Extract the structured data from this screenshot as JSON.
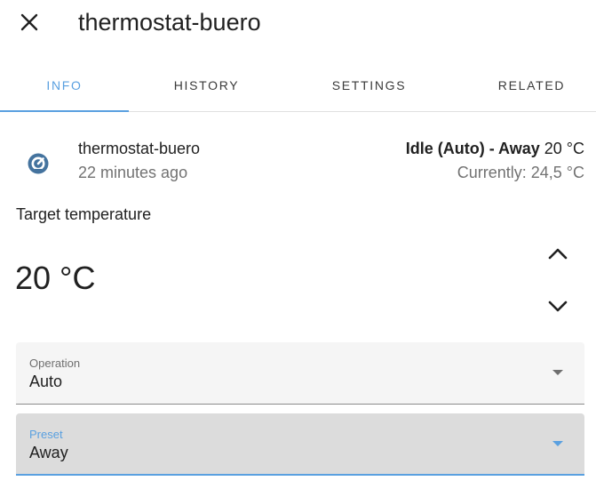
{
  "header": {
    "title": "thermostat-buero",
    "close_icon": "close-icon"
  },
  "tabs": [
    {
      "label": "INFO",
      "active": true
    },
    {
      "label": "HISTORY",
      "active": false
    },
    {
      "label": "SETTINGS",
      "active": false
    },
    {
      "label": "RELATED",
      "active": false
    }
  ],
  "entity": {
    "icon": "thermostat-icon",
    "name": "thermostat-buero",
    "last_changed": "22 minutes ago",
    "state_bold": "Idle (Auto) - Away",
    "target": "20 °C",
    "current": "Currently: 24,5 °C"
  },
  "target_temperature": {
    "label": "Target temperature",
    "value": "20 °C",
    "up_icon": "chevron-up-icon",
    "down_icon": "chevron-down-icon"
  },
  "operation": {
    "label": "Operation",
    "value": "Auto"
  },
  "preset": {
    "label": "Preset",
    "value": "Away"
  },
  "colors": {
    "accent": "#5aa0e0",
    "icon": "#44739e",
    "text_primary": "#212121",
    "text_secondary": "#727272"
  }
}
